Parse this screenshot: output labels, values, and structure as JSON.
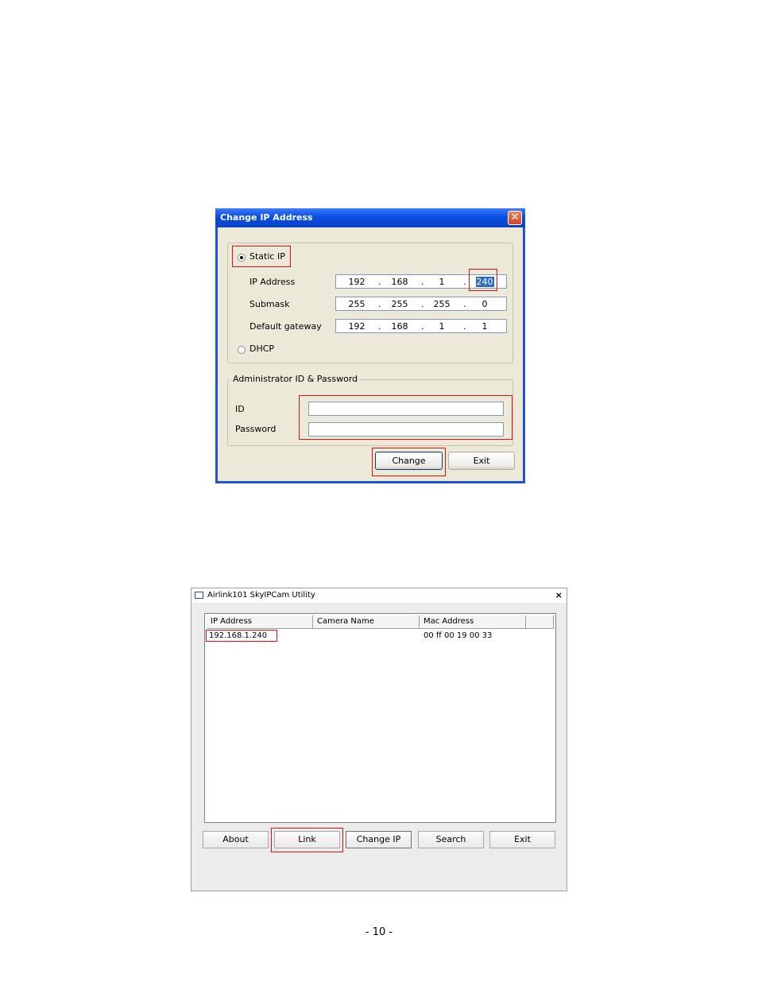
{
  "change_ip_dialog": {
    "title": "Change IP Address",
    "close_glyph": "✕",
    "static_ip_label": "Static IP",
    "static_ip_selected": true,
    "ip_address_label": "IP Address",
    "ip_address": [
      "192",
      "168",
      "1",
      "240"
    ],
    "submask_label": "Submask",
    "submask": [
      "255",
      "255",
      "255",
      "0"
    ],
    "gateway_label": "Default gateway",
    "gateway": [
      "192",
      "168",
      "1",
      "1"
    ],
    "dot": ".",
    "dhcp_label": "DHCP",
    "admin_group_label": "Administrator ID & Password",
    "id_label": "ID",
    "id_value": "",
    "password_label": "Password",
    "password_value": "",
    "change_button": "Change",
    "exit_button": "Exit"
  },
  "utility_window": {
    "title": "Airlink101 SkyIPCam Utility",
    "close_glyph": "×",
    "columns": [
      "IP Address",
      "Camera Name",
      "Mac Address"
    ],
    "rows": [
      {
        "ip": "192.168.1.240",
        "camera_name": "",
        "mac": "00 ff 00 19 00 33"
      }
    ],
    "buttons": {
      "about": "About",
      "link": "Link",
      "change_ip": "Change IP",
      "search": "Search",
      "exit": "Exit"
    }
  },
  "page_number": "- 10 -",
  "colors": {
    "xp_title_blue": "#0a4fe0",
    "dialog_face": "#ece9d8",
    "highlight_red": "#e01010",
    "selection_blue": "#316ac5"
  }
}
